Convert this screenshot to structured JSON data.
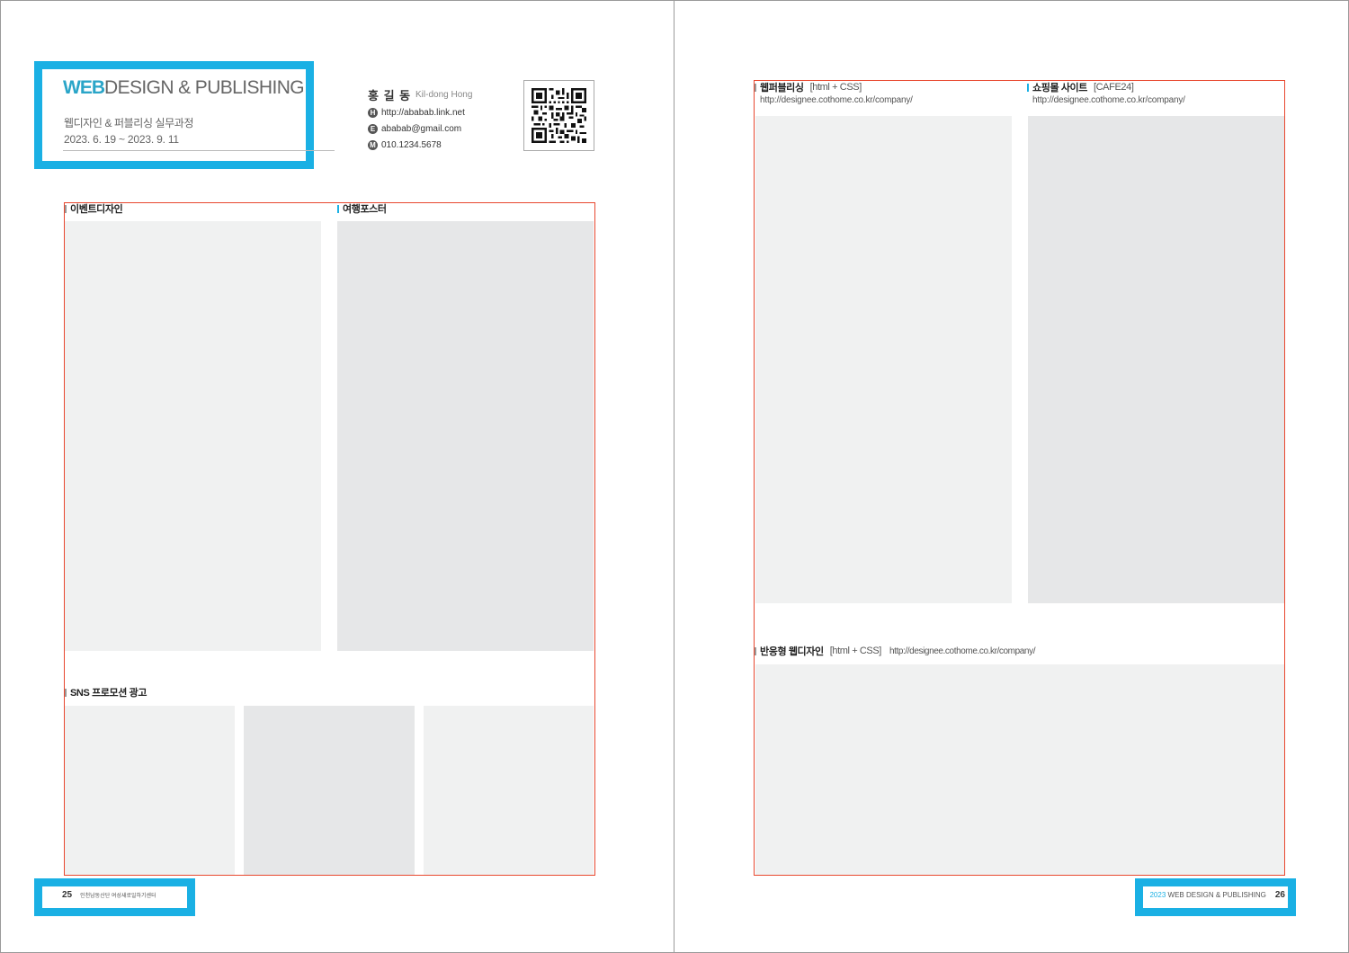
{
  "header": {
    "title_accent": "WEB",
    "title_rest": "DESIGN & PUBLISHING",
    "subtitle": "웹디자인 & 퍼블리싱 실무과정",
    "period": "2023. 6. 19 ~ 2023. 9. 11"
  },
  "profile": {
    "name": "홍 길 동",
    "name_en": "Kil-dong Hong",
    "contacts": [
      {
        "badge": "H",
        "value": "http://ababab.link.net"
      },
      {
        "badge": "E",
        "value": "ababab@gmail.com"
      },
      {
        "badge": "M",
        "value": "010.1234.5678"
      }
    ]
  },
  "left_page": {
    "sections": [
      {
        "label": "이벤트디자인"
      },
      {
        "label": "여행포스터"
      },
      {
        "label": "SNS 프로모션 광고"
      }
    ],
    "footer": {
      "page_number": "25",
      "org": "인천남동산단 여성새로일하기센터"
    }
  },
  "right_page": {
    "sections": [
      {
        "label": "웹퍼블리싱",
        "tag": "[html + CSS]",
        "url": "http://designee.cothome.co.kr/company/"
      },
      {
        "label": "쇼핑몰 사이트",
        "tag": "[CAFE24]",
        "url": "http://designee.cothome.co.kr/company/"
      },
      {
        "label": "반응형 웹디자인",
        "tag": "[html + CSS]",
        "url": "http://designee.cothome.co.kr/company/"
      }
    ],
    "footer": {
      "year": "2023",
      "title": "WEB DESIGN & PUBLISHING",
      "page_number": "26"
    }
  },
  "colors": {
    "accent_blue": "#1ab0e4",
    "title_teal": "#2aa5c8",
    "frame_red": "#e8482f",
    "placeholder_light": "#f0f1f1",
    "placeholder_dark": "#e6e7e8"
  },
  "icons": {
    "qr_code": "qr-code-icon",
    "section_marker": "section-marker-icon"
  }
}
